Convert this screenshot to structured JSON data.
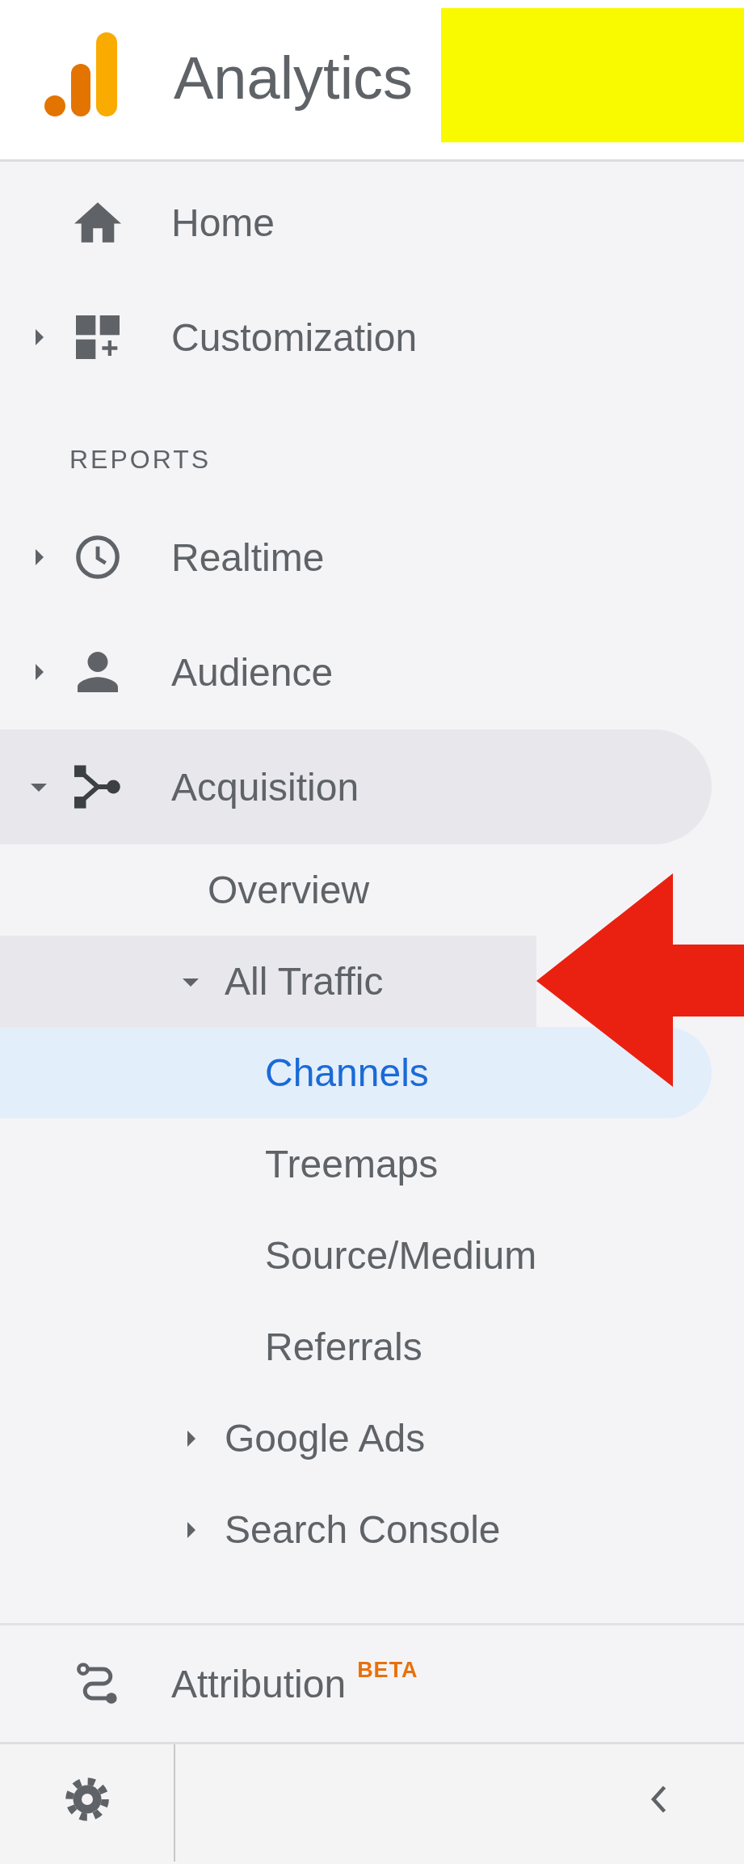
{
  "header": {
    "product": "Analytics"
  },
  "nav": [
    {
      "kind": "item",
      "label": "Home",
      "selected": false
    },
    {
      "kind": "item",
      "label": "Customization",
      "expanded": false,
      "selected": false
    },
    {
      "kind": "section",
      "label": "REPORTS"
    },
    {
      "kind": "item",
      "label": "Realtime",
      "expanded": false,
      "selected": false
    },
    {
      "kind": "item",
      "label": "Audience",
      "expanded": false,
      "selected": false
    },
    {
      "kind": "item",
      "label": "Acquisition",
      "expanded": true,
      "selected": false,
      "children": [
        {
          "label": "Overview",
          "selected": false
        },
        {
          "label": "All Traffic",
          "expanded": true,
          "selected": false,
          "children": [
            {
              "label": "Channels",
              "selected": true
            },
            {
              "label": "Treemaps",
              "selected": false
            },
            {
              "label": "Source/Medium",
              "selected": false
            },
            {
              "label": "Referrals",
              "selected": false
            }
          ]
        },
        {
          "label": "Google Ads",
          "expanded": false,
          "selected": false
        },
        {
          "label": "Search Console",
          "expanded": false,
          "selected": false
        }
      ]
    }
  ],
  "attribution": {
    "label": "Attribution",
    "badge": "BETA",
    "selected": false
  }
}
